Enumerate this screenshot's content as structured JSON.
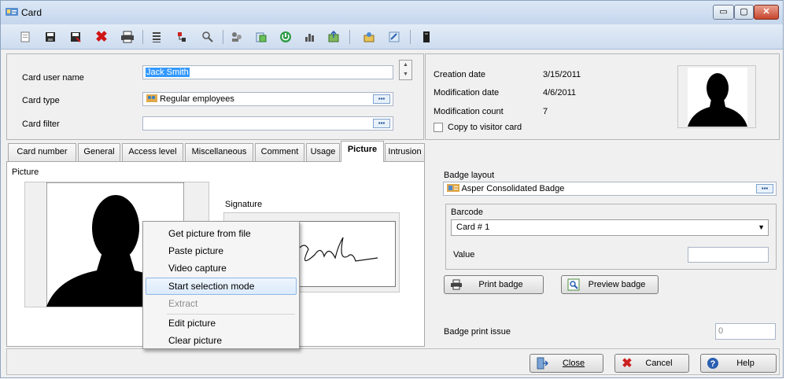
{
  "window": {
    "title": "Card",
    "controls": {
      "minimize": "▭",
      "maximize": "▢",
      "close": "✕"
    }
  },
  "toolbar": {
    "icons": [
      "new-card-icon",
      "save-icon",
      "save-as-icon",
      "delete-icon",
      "print-icon",
      "list-icon",
      "tree-icon",
      "find-icon",
      "group-icon",
      "copy-icon",
      "power-icon",
      "chart-icon",
      "export-icon",
      "import-icon",
      "link-icon",
      "card-reader-icon"
    ]
  },
  "header": {
    "card_user_name_label": "Card user name",
    "card_user_name_value": "Jack Smith",
    "card_type_label": "Card type",
    "card_type_value": "Regular employees",
    "card_filter_label": "Card filter",
    "card_filter_value": "",
    "browse_glyph": "▪▪▪"
  },
  "info": {
    "creation_date_label": "Creation date",
    "creation_date_value": "3/15/2011",
    "modification_date_label": "Modification date",
    "modification_date_value": "4/6/2011",
    "modification_count_label": "Modification count",
    "modification_count_value": "7",
    "copy_to_visitor_label": "Copy to visitor card"
  },
  "tabs": [
    {
      "label": "Card number"
    },
    {
      "label": "General"
    },
    {
      "label": "Access level"
    },
    {
      "label": "Miscellaneous"
    },
    {
      "label": "Comment"
    },
    {
      "label": "Usage"
    },
    {
      "label": "Picture"
    },
    {
      "label": "Intrusion"
    }
  ],
  "active_tab": "Picture",
  "picture_tab": {
    "picture_label": "Picture",
    "signature_label": "Signature"
  },
  "context_menu": {
    "items": [
      {
        "label": "Get picture from file"
      },
      {
        "label": "Paste picture"
      },
      {
        "label": "Video capture"
      },
      {
        "label": "Start selection mode"
      },
      {
        "label": "Extract"
      },
      {
        "label": "Edit picture"
      },
      {
        "label": "Clear picture"
      }
    ],
    "highlighted": "Start selection mode",
    "disabled": [
      "Extract"
    ]
  },
  "badge": {
    "layout_label": "Badge layout",
    "layout_value": "Asper Consolidated Badge",
    "barcode_label": "Barcode",
    "barcode_value": "Card # 1",
    "value_label": "Value",
    "value_value": "",
    "print_badge_label": "Print badge",
    "preview_badge_label": "Preview badge",
    "print_issue_label": "Badge print issue",
    "print_issue_value": "0"
  },
  "footer": {
    "close_label": "Close",
    "cancel_label": "Cancel",
    "help_label": "Help"
  },
  "colors": {
    "title_gradient_top": "#dbe7f6",
    "selection": "#3399ff",
    "cancel_x": "#cc1f1f",
    "help_blue": "#2a5fb0"
  }
}
